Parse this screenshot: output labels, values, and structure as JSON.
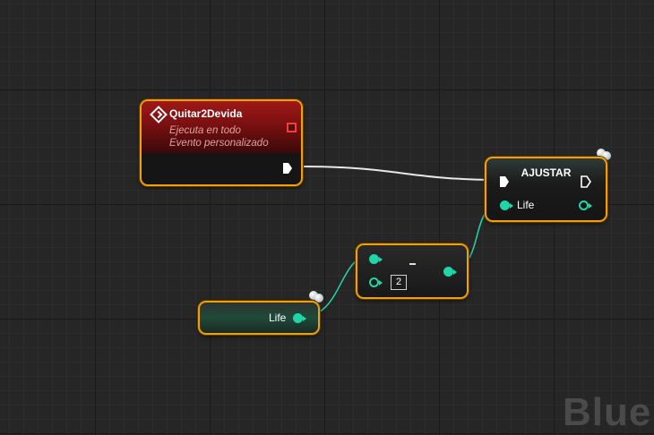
{
  "event_node": {
    "title": "Quitar2Devida",
    "subtitle_1": "Ejecuta en todo",
    "subtitle_2": "Evento personalizado"
  },
  "set_node": {
    "title": "AJUSTAR",
    "input_label": "Life"
  },
  "subtract_node": {
    "operator": "-",
    "b_value": "2"
  },
  "get_node": {
    "label": "Life"
  },
  "watermark": "Blue",
  "colors": {
    "selection_outline": "#f0a000",
    "event_header": "#a01818",
    "float_pin": "#20d6a8",
    "exec_wire": "#ffffff"
  }
}
